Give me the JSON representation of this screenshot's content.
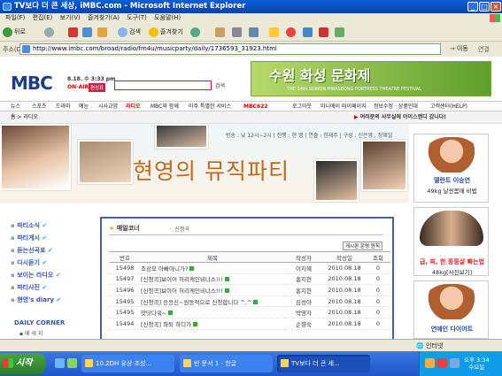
{
  "window": {
    "title": "TV보다 더 큰 세상, iMBC.com - Microsoft Internet Explorer"
  },
  "menu": [
    "파일(F)",
    "편집(E)",
    "보기(V)",
    "즐겨찾기(A)",
    "도구(T)",
    "도움말(H)"
  ],
  "toolbar": {
    "back": "뒤로",
    "search": "검색",
    "favorites": "즐겨찾기"
  },
  "address": {
    "label": "주소(D)",
    "url": "http://www.imbc.com/broad/radio/fm4u/musicparty/daily/1736593_31923.html",
    "go": "이동",
    "links": "연결"
  },
  "header": {
    "logo": "MBC",
    "date": "8.18. 수 3:33 pm",
    "onair": "ON-AIR",
    "custom": "편성표",
    "search_button": "검색",
    "festival_title": "수원 화성 문화제",
    "festival_sub": "THE 14th SUWON HWASEONG FORTRESS THEATRE FESTIVAL"
  },
  "nav": {
    "items": [
      "뉴스",
      "스포츠",
      "드라마",
      "예능",
      "시사교양",
      "라디오",
      "MBC와 함께",
      "아주 특별한 서비스",
      "MBC622",
      "로그아웃",
      "미니에이 마이페이지",
      "정보수정 · 상품인대",
      "고객센터(HELP)"
    ]
  },
  "breadcrumb": "홈 > 라디오",
  "ticker": "여러분의 사무실에 아이스캔디 갑니다!",
  "program": {
    "info": "방송 : 낮 12시~2시 | 진행 : 현 영 | 연출 : 한재주 | 구성 : 신은영 , 장혜일",
    "title": "현영의 뮤직파티"
  },
  "left_menu": {
    "items": [
      "파티소식",
      "파티게시",
      "듣는선곡표",
      "다시듣기",
      "보이는 라디오",
      "파티사진",
      "현영's diary"
    ],
    "daily_corner": "DAILY CORNER",
    "daily_item": "▪ 메 세 지"
  },
  "board": {
    "heading": "매일코너",
    "sub": "ㆍ 신청곡",
    "write_button": "게시판 운영 원칙",
    "columns": [
      "번호",
      "제목",
      "작성자",
      "작성일",
      "조회"
    ],
    "rows": [
      [
        "15498",
        "조상모 아빠아니가?",
        "이지혜",
        "2010.08.18",
        "0"
      ],
      [
        "15497",
        "[신청곡]보이어 허리케인비너스!!!",
        "홍지현",
        "2010.08.18",
        "0"
      ],
      [
        "15496",
        "[신청곡]보이어 허리케인비너스!!!",
        "홍지현",
        "2010.08.18",
        "0"
      ],
      [
        "15495",
        "[신청곡] 응응신~원동적으로 신청합니다 ^,^",
        "김성아",
        "2010.08.18",
        "0"
      ],
      [
        "15495",
        "앗닷다워~",
        "박영자",
        "2010.08.18",
        "0"
      ],
      [
        "15494",
        "[신청곡] 좌퇴 하디가",
        "손향숙",
        "2010.08.18",
        "0"
      ]
    ]
  },
  "ads": [
    {
      "line1": "델란트 이승연",
      "line2": "49kg 날씬몸매 비법"
    },
    {
      "line1": "급, 찌, 한 뚱뚱살 빠는법",
      "line2": "48kg[사진보기]"
    },
    {
      "line1": "연예인 다이어트",
      "line2": ""
    }
  ],
  "statusbar": {
    "zone": "인터넷"
  },
  "taskbar": {
    "start": "시작",
    "items": [
      "10.2DH 유상 조성...",
      "빈 문서 1 - 한글",
      "TV보다 더 큰 세..."
    ],
    "time": "오후 3:34",
    "day": "수요일"
  },
  "colors": {
    "xp_blue": "#0a5fd8",
    "mbc_blue": "#1d3c8a",
    "board_border": "#4a5fa5",
    "accent_red": "#d00"
  }
}
